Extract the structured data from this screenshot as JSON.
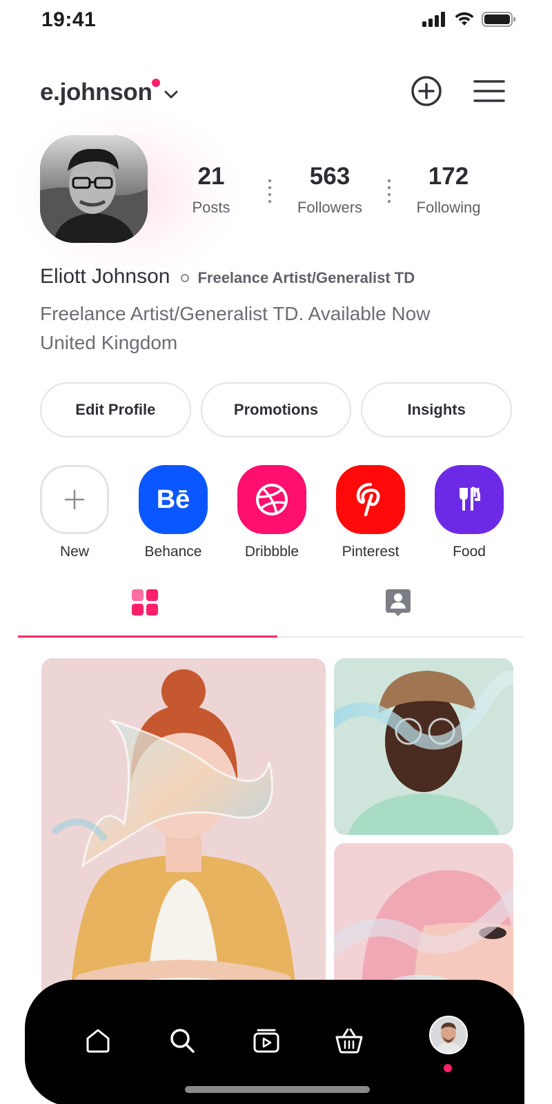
{
  "status_bar": {
    "time": "19:41"
  },
  "header": {
    "username": "e.johnson"
  },
  "stats": [
    {
      "value": "21",
      "label": "Posts"
    },
    {
      "value": "563",
      "label": "Followers"
    },
    {
      "value": "172",
      "label": "Following"
    }
  ],
  "profile": {
    "full_name": "Eliott Johnson",
    "category": "Freelance Artist/Generalist TD",
    "bio_line1": "Freelance Artist/Generalist TD. Available Now",
    "bio_line2": "United Kingdom"
  },
  "actions": {
    "edit_profile": "Edit Profile",
    "promotions": "Promotions",
    "insights": "Insights"
  },
  "highlights": [
    {
      "label": "New",
      "icon": "plus-icon"
    },
    {
      "label": "Behance",
      "icon": "behance-icon",
      "color": "#0b57ff"
    },
    {
      "label": "Dribbble",
      "icon": "dribbble-icon",
      "color": "#ff0f6e"
    },
    {
      "label": "Pinterest",
      "icon": "pinterest-icon",
      "color": "#ff0a0a"
    },
    {
      "label": "Food",
      "icon": "utensils-icon",
      "color": "#6d2ae6"
    }
  ],
  "highlight_logos": {
    "behance": "Bē"
  },
  "tabs": [
    {
      "icon": "grid-icon",
      "active": true
    },
    {
      "icon": "tagged-user-icon",
      "active": false
    }
  ],
  "bottom_nav": [
    {
      "icon": "home-icon"
    },
    {
      "icon": "search-icon"
    },
    {
      "icon": "reels-icon"
    },
    {
      "icon": "shop-basket-icon"
    },
    {
      "icon": "profile-avatar",
      "active": true
    }
  ],
  "colors": {
    "accent": "#ff1f6b",
    "tab_active": "#ff2b5e",
    "text_primary": "#2a2c33",
    "text_secondary": "#6b6d75"
  }
}
